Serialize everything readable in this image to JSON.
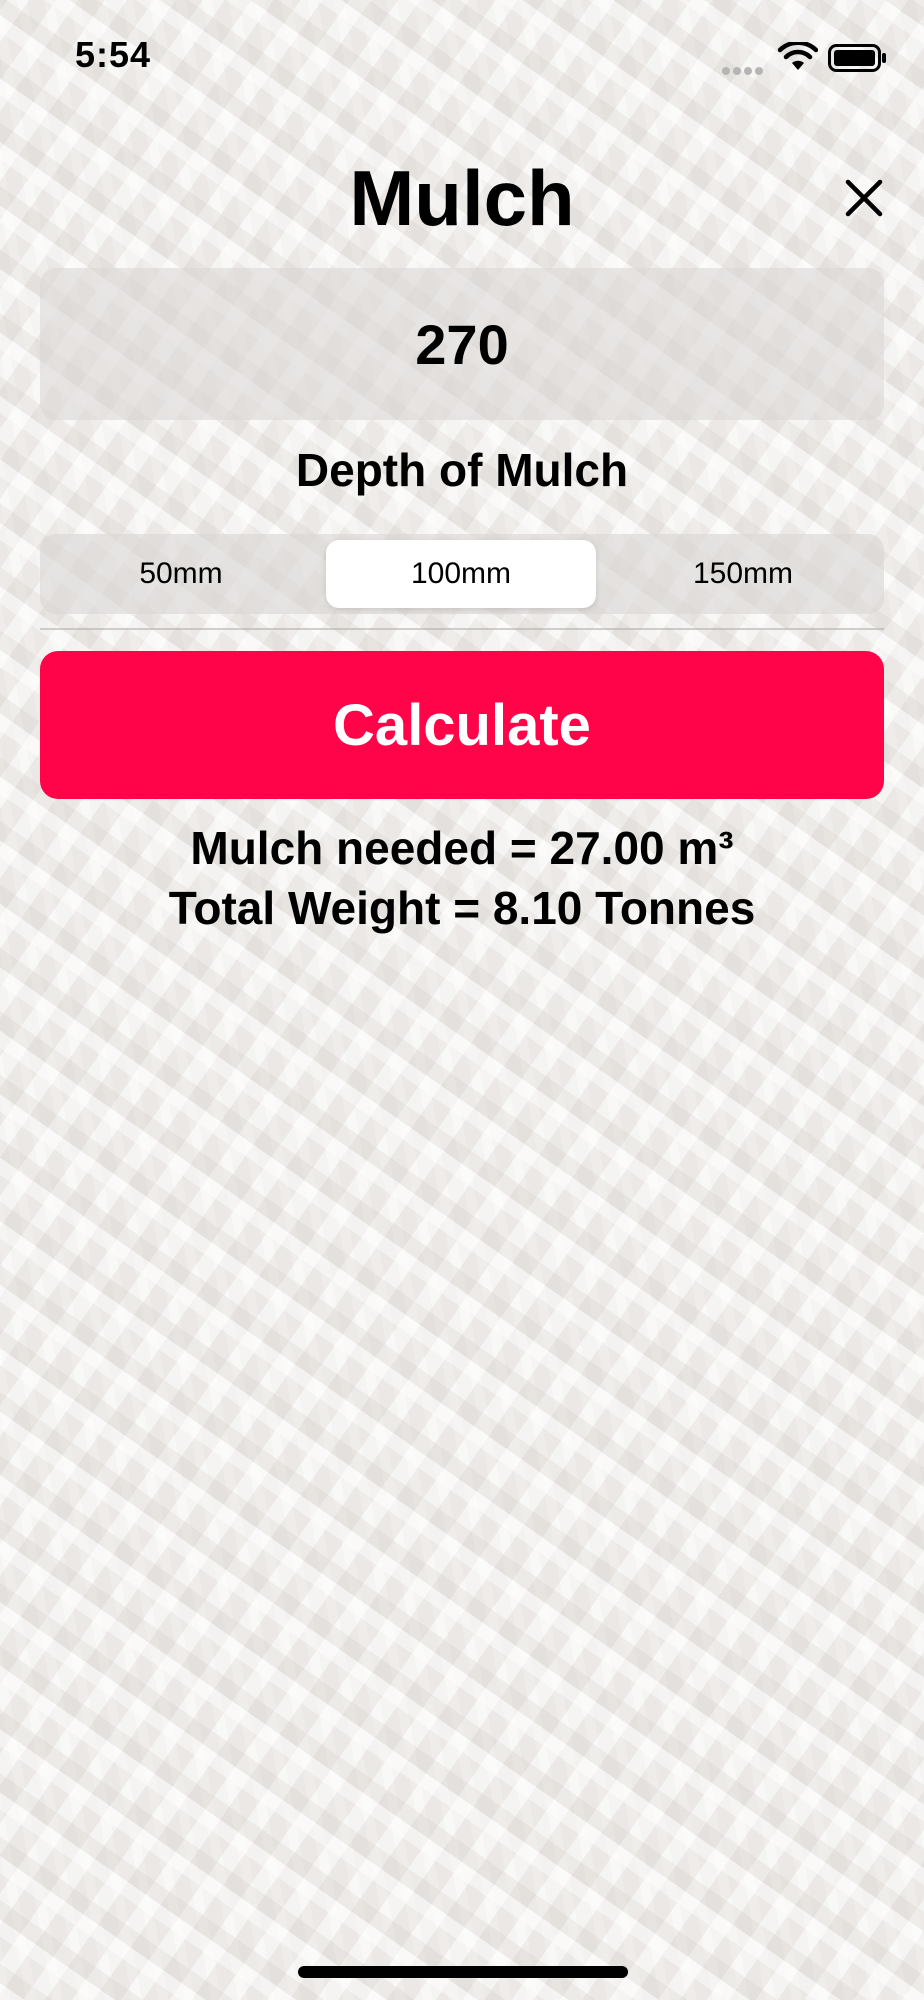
{
  "status_bar": {
    "time": "5:54",
    "icons": [
      "signal-icon",
      "wifi-icon",
      "battery-icon"
    ]
  },
  "header": {
    "title": "Mulch",
    "close_icon": "close-icon"
  },
  "input": {
    "amount_value": "270"
  },
  "depth": {
    "label": "Depth of Mulch",
    "options": [
      "50mm",
      "100mm",
      "150mm"
    ],
    "selected": "100mm"
  },
  "actions": {
    "calculate_label": "Calculate"
  },
  "results": {
    "volume_text": "Mulch needed = 27.00 m³",
    "weight_text": "Total Weight = 8.10 Tonnes"
  },
  "colors": {
    "accent": "#ff0448",
    "background": "#efecea"
  }
}
